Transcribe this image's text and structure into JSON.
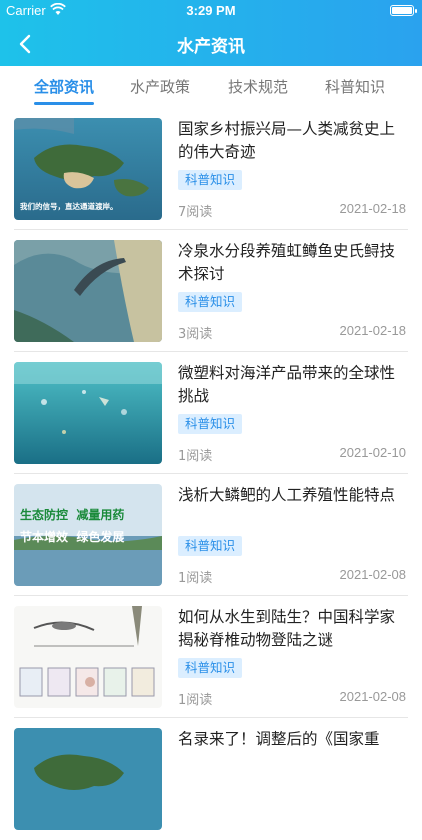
{
  "status_bar": {
    "carrier": "Carrier",
    "time": "3:29 PM"
  },
  "header": {
    "title": "水产资讯"
  },
  "tabs": [
    {
      "label": "全部资讯",
      "active": true
    },
    {
      "label": "水产政策",
      "active": false
    },
    {
      "label": "技术规范",
      "active": false
    },
    {
      "label": "科普知识",
      "active": false
    }
  ],
  "articles": [
    {
      "title": "国家乡村振兴局—人类减贫史上的伟大奇迹",
      "tag": "科普知识",
      "reads": "7阅读",
      "date": "2021-02-18",
      "image_caption": "我们的信号，直达通道渡岸。",
      "image": "island-aerial"
    },
    {
      "title": "冷泉水分段养殖虹鳟鱼史氏鲟技术探讨",
      "tag": "科普知识",
      "reads": "3阅读",
      "date": "2021-02-18",
      "image": "sturgeon-water"
    },
    {
      "title": "微塑料对海洋产品带来的全球性挑战",
      "tag": "科普知识",
      "reads": "1阅读",
      "date": "2021-02-10",
      "image": "ocean-plastic"
    },
    {
      "title": "浅析大鳞鲃的人工养殖性能特点",
      "tag": "科普知识",
      "reads": "1阅读",
      "date": "2021-02-08",
      "image_caption_1": "生态防控  减量用药",
      "image_caption_2": "节本增效  绿色发展",
      "image": "lake-slogan"
    },
    {
      "title": "如何从水生到陆生？中国科学家揭秘脊椎动物登陆之谜",
      "tag": "科普知识",
      "reads": "1阅读",
      "date": "2021-02-08",
      "image": "evolution-diagram"
    },
    {
      "title": "名录来了！调整后的《国家重",
      "image": "island-aerial"
    }
  ],
  "colors": {
    "header_start": "#1ec2ea",
    "header_end": "#2aa2ee",
    "accent": "#2a8fe8",
    "tag_bg": "#dbeeff"
  }
}
